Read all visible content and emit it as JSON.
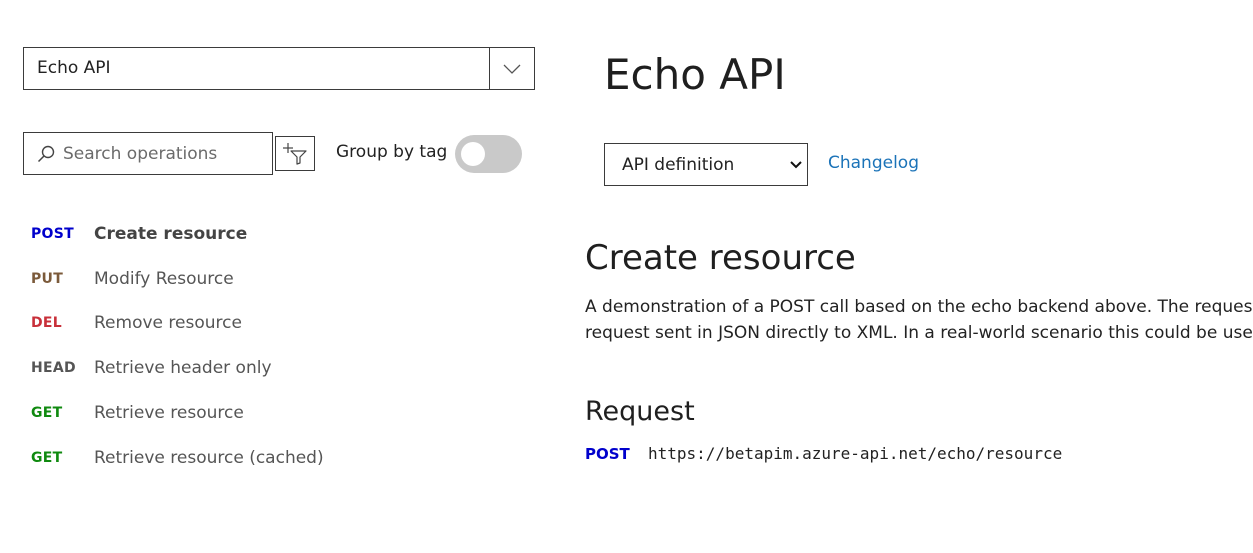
{
  "api_selector": {
    "value": "Echo API"
  },
  "search": {
    "placeholder": "Search operations"
  },
  "group_by_tag": {
    "label": "Group by tag",
    "enabled": false
  },
  "operations": [
    {
      "method": "POST",
      "name": "Create resource",
      "active": true
    },
    {
      "method": "PUT",
      "name": "Modify Resource",
      "active": false
    },
    {
      "method": "DEL",
      "name": "Remove resource",
      "active": false
    },
    {
      "method": "HEAD",
      "name": "Retrieve header only",
      "active": false
    },
    {
      "method": "GET",
      "name": "Retrieve resource",
      "active": false
    },
    {
      "method": "GET",
      "name": "Retrieve resource (cached)",
      "active": false
    }
  ],
  "method_colors": {
    "POST": "#0000cc",
    "PUT": "#7b5a3a",
    "DEL": "#c8303a",
    "HEAD": "#555555",
    "GET": "#108a10"
  },
  "main": {
    "title": "Echo API",
    "definition_select": {
      "value": "API definition"
    },
    "changelog_label": "Changelog",
    "operation": {
      "title": "Create resource",
      "description": [
        "A demonstration of a POST call based on the echo backend above. The request bo",
        "request sent in JSON directly to XML. In a real-world scenario this could be used to"
      ],
      "request_heading": "Request",
      "request_method": "POST",
      "request_url": "https://betapim.azure-api.net/echo/resource"
    }
  },
  "colors": {
    "accent_link": "#1b73b8",
    "toggle_off": "#c9c9c9"
  }
}
